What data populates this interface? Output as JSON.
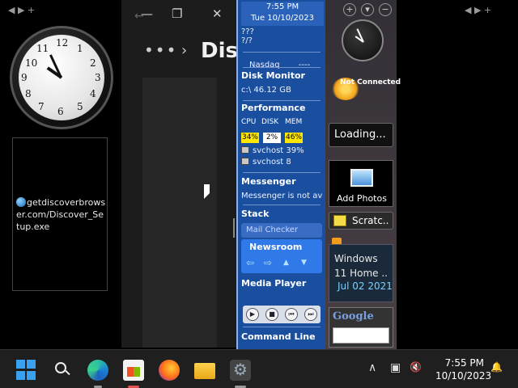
{
  "desktop": {
    "left_arrows": "◀ ▶ +",
    "right_arrows": "◀ ▶ +",
    "download_file": "getdiscoverbrowser.com/Discover_Setup.exe",
    "clock_numbers": [
      "12",
      "1",
      "2",
      "3",
      "4",
      "5",
      "6",
      "7",
      "8",
      "9",
      "10",
      "11"
    ]
  },
  "explorer": {
    "title": "Disp",
    "dots": "•••",
    "chevron": "›",
    "back": "←",
    "min": "—",
    "max": "❐",
    "close": "✕"
  },
  "sidebar": {
    "time": "7:55 PM",
    "date": "Tue 10/10/2023",
    "weather_line1": "???",
    "weather_line2": "?/?",
    "stock_label": "Nasdaq",
    "stock_value": "----",
    "disk_monitor": {
      "title": "Disk Monitor",
      "value": "c:\\ 46.12 GB"
    },
    "performance": {
      "title": "Performance",
      "labels": [
        "CPU",
        "DISK",
        "MEM"
      ],
      "values": [
        "34%",
        "2%",
        "46%"
      ],
      "processes": [
        "svchost 39%",
        "svchost 8"
      ]
    },
    "messenger": {
      "title": "Messenger",
      "status": "Messenger is not av"
    },
    "stack": {
      "title": "Stack",
      "mail_checker": "Mail Checker"
    },
    "newsroom": {
      "title": "Newsroom",
      "arrows": [
        "⇦",
        "⇨",
        "▲",
        "▼"
      ]
    },
    "media_player": {
      "title": "Media Player",
      "buttons": [
        "▶",
        "■",
        "⏮",
        "⏭"
      ]
    },
    "command_line": {
      "title": "Command Line"
    }
  },
  "right_gadgets": {
    "buttons": [
      "+",
      "▾",
      "−"
    ],
    "weather_status": "Not Connected",
    "loading": "Loading...",
    "photos_label": "Add Photos",
    "scratch_label": "Scratc..",
    "feed_line1": "Windows",
    "feed_line2": "11 Home ..",
    "feed_date": "Jul 02 2021",
    "google_logo": "Google"
  },
  "taskbar": {
    "time": "7:55 PM",
    "date": "10/10/2023",
    "tray_chevron": "∧",
    "tray_display": "▣",
    "tray_speaker": "🔇",
    "tray_bell": "🔔"
  },
  "colors": {
    "sidebar_blue": "#1a4fa0",
    "newsroom_blue": "#2f79e8",
    "perf_yellow": "#ffe600",
    "windows_blue": "#3aa0f0"
  }
}
